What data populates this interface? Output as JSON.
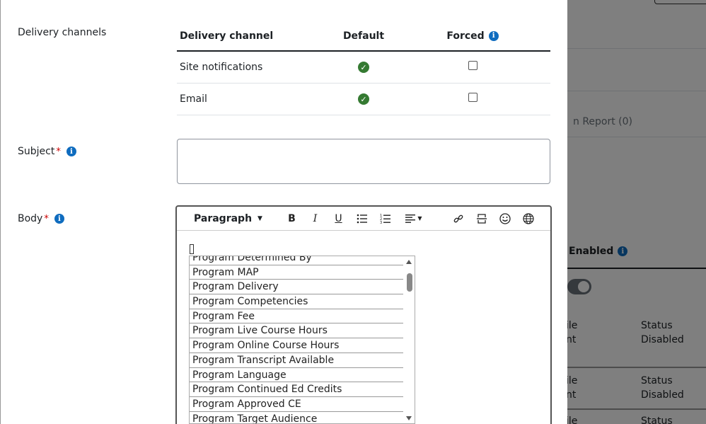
{
  "background": {
    "report_label": "n Report (0)",
    "enabled_label": "Enabled",
    "rows": [
      {
        "left_top": "ile",
        "left_bottom": "nt",
        "status_label": "Status",
        "status_value": "Disabled"
      },
      {
        "left_top": "ile",
        "left_bottom": "nt",
        "status_label": "Status",
        "status_value": "Disabled"
      },
      {
        "left_top": "ile",
        "left_bottom": "",
        "status_label": "Status",
        "status_value": ""
      }
    ]
  },
  "form": {
    "delivery_label": "Delivery channels",
    "table_headers": {
      "channel": "Delivery channel",
      "default": "Default",
      "forced": "Forced"
    },
    "channels": [
      {
        "name": "Site notifications",
        "default_checked": true,
        "forced": false
      },
      {
        "name": "Email",
        "default_checked": true,
        "forced": false
      }
    ],
    "subject_label": "Subject",
    "subject_value": "",
    "body_label": "Body",
    "required_mark": "*",
    "info_icon": "i"
  },
  "editor": {
    "block_format": "Paragraph",
    "toolbar": {
      "bold": "B",
      "italic": "I",
      "underline": "U"
    }
  },
  "placeholder_dropdown": {
    "items": [
      "Program Determined By",
      "Program MAP",
      "Program Delivery",
      "Program Competencies",
      "Program Fee",
      "Program Live Course Hours",
      "Program Online Course Hours",
      "Program Transcript Available",
      "Program Language",
      "Program Continued Ed Credits",
      "Program Approved CE",
      "Program Target Audience"
    ]
  }
}
